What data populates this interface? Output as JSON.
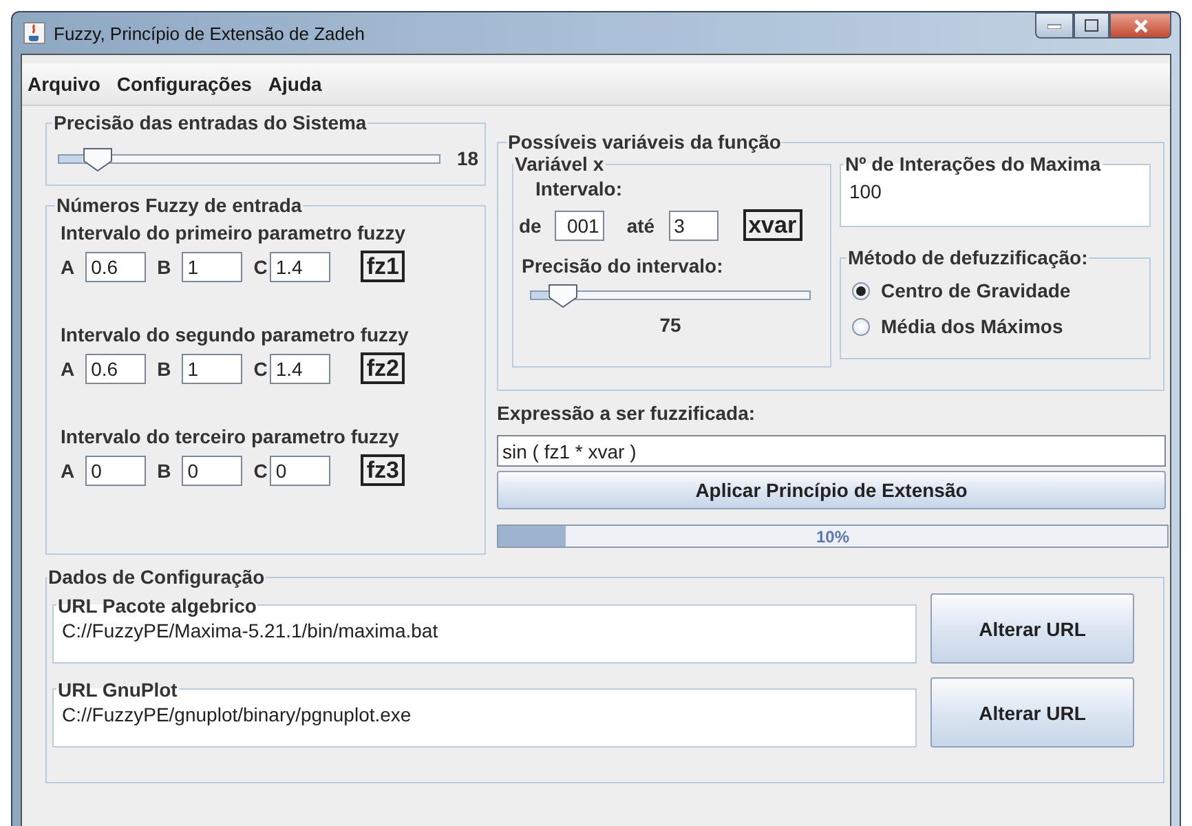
{
  "window": {
    "title": "Fuzzy, Princípio de Extensão de Zadeh"
  },
  "menu": [
    {
      "label": "Arquivo"
    },
    {
      "label": "Configurações"
    },
    {
      "label": "Ajuda"
    }
  ],
  "system_precision": {
    "title": "Precisão das entradas do Sistema",
    "level": 0.06,
    "reading": "18"
  },
  "fuzzy_inputs": {
    "title": "Números Fuzzy de entrada",
    "params": [
      {
        "label": "Intervalo do primeiro parametro fuzzy",
        "fields": [
          {
            "label": "A",
            "value": "0.6"
          },
          {
            "label": "B",
            "value": "1"
          },
          {
            "label": "C",
            "value": "1.4"
          }
        ],
        "tag": "fz1"
      },
      {
        "label": "Intervalo do segundo parametro fuzzy",
        "fields": [
          {
            "label": "A",
            "value": "0.6"
          },
          {
            "label": "B",
            "value": "1"
          },
          {
            "label": "C",
            "value": "1.4"
          }
        ],
        "tag": "fz2"
      },
      {
        "label": "Intervalo do terceiro parametro fuzzy",
        "fields": [
          {
            "label": "A",
            "value": "0"
          },
          {
            "label": "B",
            "value": "0"
          },
          {
            "label": "C",
            "value": "0"
          }
        ],
        "tag": "fz3"
      }
    ]
  },
  "function_vars": {
    "title": "Possíveis variáveis da função",
    "variable": {
      "title": "Variável x",
      "interval_label": "Intervalo:",
      "from_label": "de",
      "from_value": "001",
      "to_label": "até",
      "to_value": "3",
      "tag": "xvar",
      "precision_label": "Precisão do intervalo:",
      "level": 0.06,
      "reading": "75"
    },
    "iterations": {
      "title": "Nº de Interações do Maxima",
      "value": "100"
    },
    "defuzz": {
      "title": "Método de defuzzificação:",
      "options": [
        {
          "label": "Centro de Gravidade",
          "selected": true
        },
        {
          "label": "Média dos Máximos",
          "selected": false
        }
      ]
    }
  },
  "expression": {
    "label": "Expressão a ser fuzzificada:",
    "value": "sin ( fz1 * xvar )"
  },
  "apply_button": "Aplicar Princípio de Extensão",
  "progress": {
    "level": 0.1,
    "reading": "10%"
  },
  "config": {
    "title": "Dados de Configuração",
    "urls": [
      {
        "title": "URL Pacote algebrico",
        "value": "C://FuzzyPE/Maxima-5.21.1/bin/maxima.bat",
        "button": "Alterar URL"
      },
      {
        "title": "URL GnuPlot",
        "value": "C://FuzzyPE/gnuplot/binary/pgnuplot.exe",
        "button": "Alterar URL"
      }
    ]
  }
}
